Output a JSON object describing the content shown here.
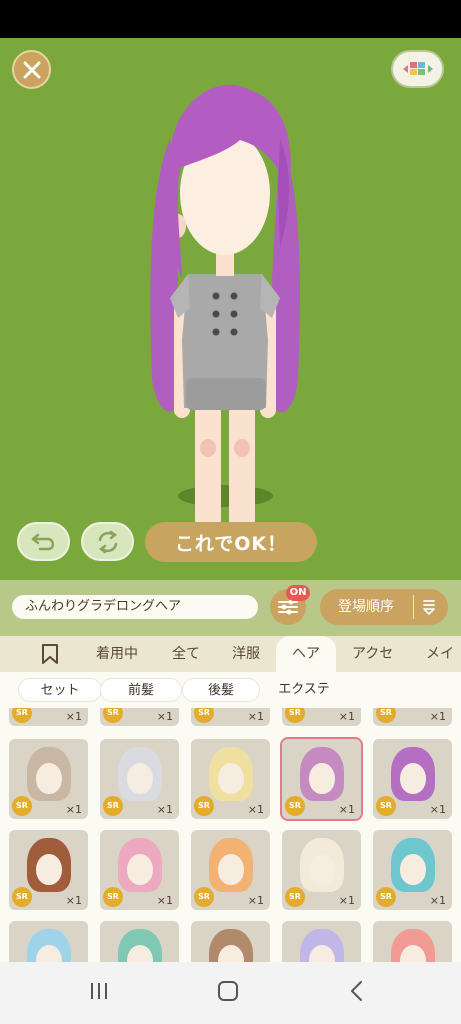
{
  "confirm_label": "これでOK！",
  "outfit_name": "ふんわりグラデロングヘア",
  "filter_badge": "ON",
  "sort_label": "登場順序",
  "tabs": [
    "着用中",
    "全て",
    "洋服",
    "ヘア",
    "アクセ",
    "メイク"
  ],
  "active_tab": "ヘア",
  "subtabs": [
    "セット",
    "前髪",
    "後髪",
    "エクステ"
  ],
  "items": [
    {
      "rarity": "SR",
      "qty": "×1",
      "hair": "#c9b7a4"
    },
    {
      "rarity": "SR",
      "qty": "×1",
      "hair": "#d9dbe0"
    },
    {
      "rarity": "SR",
      "qty": "×1",
      "hair": "#efe0a0"
    },
    {
      "rarity": "SR",
      "qty": "×1",
      "hair": "#c58bc0"
    },
    {
      "rarity": "SR",
      "qty": "×1",
      "hair": "#b46ec2"
    },
    {
      "rarity": "SR",
      "qty": "×1",
      "hair": "#a15c3c"
    },
    {
      "rarity": "SR",
      "qty": "×1",
      "hair": "#eca9bf"
    },
    {
      "rarity": "SR",
      "qty": "×1",
      "hair": "#f2b273"
    },
    {
      "rarity": "SR",
      "qty": "×1",
      "hair": "#f3ead9"
    },
    {
      "rarity": "SR",
      "qty": "×1",
      "hair": "#6ec7cf"
    }
  ],
  "partial_top": [
    {
      "rarity": "SR",
      "qty": "×1"
    },
    {
      "rarity": "SR",
      "qty": "×1"
    },
    {
      "rarity": "SR",
      "qty": "×1"
    },
    {
      "rarity": "SR",
      "qty": "×1"
    },
    {
      "rarity": "SR",
      "qty": "×1"
    }
  ],
  "partial_bottom": [
    "#9fd3ea",
    "#7ec8b4",
    "#b08a6b",
    "#c0b6e8",
    "#f29a94"
  ],
  "icons": {
    "close": "close-icon",
    "layout": "layout-toggle-icon",
    "undo": "undo-icon",
    "rotate": "rotate-icon",
    "filter": "filter-sliders-icon",
    "sort": "sort-order-icon",
    "bookmark": "bookmark-icon"
  },
  "colors": {
    "stage_bg": "#7aa83c",
    "accent_gold": "#c7a45f",
    "selected_border": "#e57a8e",
    "rarity_badge": "#e3ac2b"
  }
}
